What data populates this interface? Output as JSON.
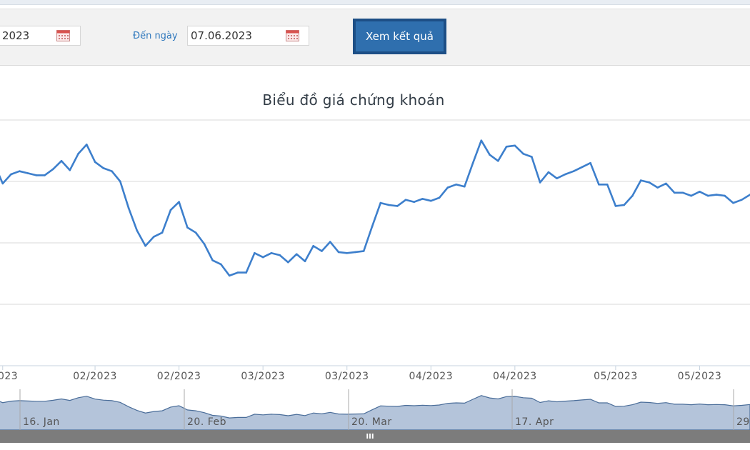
{
  "filters": {
    "from_date_value": "2023",
    "to_label": "Đến ngày",
    "to_date_value": "07.06.2023",
    "submit_label": "Xem kết quả"
  },
  "chart_data": {
    "type": "line",
    "title": "Biểu đồ giá chứng khoán",
    "xlabel": "",
    "ylabel": "",
    "grid": true,
    "x_tick_labels": [
      "/2023",
      "02/2023",
      "02/2023",
      "03/2023",
      "03/2023",
      "04/2023",
      "04/2023",
      "05/2023",
      "05/2023"
    ],
    "series": [
      {
        "color": "#3d7fcc",
        "values": [
          19.7,
          17.8,
          18.7,
          19.0,
          18.8,
          18.6,
          18.6,
          19.2,
          20.0,
          19.1,
          20.7,
          21.6,
          19.9,
          19.3,
          19.0,
          18.0,
          15.4,
          13.2,
          11.7,
          12.6,
          13.0,
          15.2,
          16.0,
          13.5,
          13.0,
          11.9,
          10.3,
          9.9,
          8.8,
          9.1,
          9.1,
          11.0,
          10.6,
          11.0,
          10.8,
          10.1,
          10.9,
          10.2,
          11.7,
          11.2,
          12.1,
          11.1,
          11.0,
          11.1,
          11.2,
          13.6,
          15.9,
          15.7,
          15.6,
          16.2,
          16.0,
          16.3,
          16.1,
          16.4,
          17.4,
          17.7,
          17.5,
          19.8,
          22.0,
          20.6,
          20.0,
          21.4,
          21.5,
          20.7,
          20.4,
          17.9,
          18.9,
          18.3,
          18.7,
          19.0,
          19.4,
          19.8,
          17.7,
          17.7,
          15.6,
          15.7,
          16.6,
          18.1,
          17.9,
          17.4,
          17.8,
          16.9,
          16.9,
          16.6,
          17.0,
          16.6,
          16.7,
          16.6,
          15.9,
          16.2,
          16.7
        ]
      }
    ],
    "navigator": {
      "series_values": [
        19.7,
        17.8,
        18.7,
        19.0,
        18.8,
        18.6,
        18.6,
        19.2,
        20.0,
        19.1,
        20.7,
        21.6,
        19.9,
        19.3,
        19.0,
        18.0,
        15.4,
        13.2,
        11.7,
        12.6,
        13.0,
        15.2,
        16.0,
        13.5,
        13.0,
        11.9,
        10.3,
        9.9,
        8.8,
        9.1,
        9.1,
        11.0,
        10.6,
        11.0,
        10.8,
        10.1,
        10.9,
        10.2,
        11.7,
        11.2,
        12.1,
        11.1,
        11.0,
        11.1,
        11.2,
        13.6,
        15.9,
        15.7,
        15.6,
        16.2,
        16.0,
        16.3,
        16.1,
        16.4,
        17.4,
        17.7,
        17.5,
        19.8,
        22.0,
        20.6,
        20.0,
        21.4,
        21.5,
        20.7,
        20.4,
        17.9,
        18.9,
        18.3,
        18.7,
        19.0,
        19.4,
        19.8,
        17.7,
        17.7,
        15.6,
        15.7,
        16.6,
        18.1,
        17.9,
        17.4,
        17.8,
        16.9,
        16.9,
        16.6,
        17.0,
        16.6,
        16.7,
        16.6,
        15.9,
        16.2,
        16.7
      ],
      "date_labels": [
        "16. Jan",
        "20. Feb",
        "20. Mar",
        "17. Apr",
        "29"
      ],
      "handle_glyph": "III"
    }
  }
}
